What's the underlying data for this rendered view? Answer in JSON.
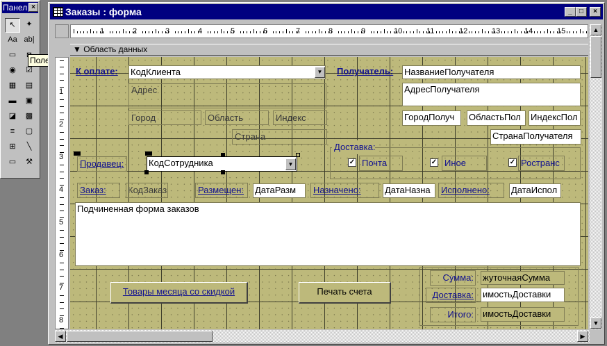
{
  "toolbox": {
    "title": "Панел",
    "tooltip": "Поле",
    "tools": [
      "↖",
      "✦",
      "Aa",
      "ab|",
      "▭",
      "◘",
      "◉",
      "☑",
      "▦",
      "▤",
      "▬",
      "▣",
      "◪",
      "▩",
      "≡",
      "▢",
      "⊞",
      "╲",
      "▭",
      "⚒"
    ]
  },
  "window": {
    "title": "Заказы : форма",
    "min": "_",
    "max": "□",
    "close": "×"
  },
  "ruler": {
    "marks": [
      "1",
      "2",
      "3",
      "4",
      "5",
      "6",
      "7",
      "8",
      "9",
      "10",
      "11",
      "12",
      "13",
      "14",
      "15"
    ],
    "vmarks": [
      "1",
      "2",
      "3",
      "4",
      "5",
      "6",
      "7",
      "8"
    ]
  },
  "section": {
    "label": "Область данных"
  },
  "form": {
    "k_oplate": "К оплате:",
    "kod_klienta": "КодКлиента",
    "adres": "Адрес",
    "gorod": "Город",
    "oblast": "Область",
    "indeks": "Индекс",
    "strana": "Страна",
    "poluchatel": "Получатель:",
    "nazv_pol": "НазваниеПолучателя",
    "adres_pol": "АдресПолучателя",
    "gorod_pol": "ГородПолуч",
    "oblast_pol": "ОбластьПол",
    "indeks_pol": "ИндексПол",
    "strana_pol": "СтранаПолучателя",
    "dostavka": "Доставка:",
    "pochta": "Почта",
    "inoe": "Иное",
    "rostrans": "Ространс",
    "prodavec": "Продавец:",
    "kod_sotr": "КодСотрудника",
    "zakaz": "Заказ:",
    "kod_zakaza": "КодЗаказ",
    "razmeshen": "Размещен:",
    "data_razm": "ДатаРазм",
    "naznacheno": "Назначено:",
    "data_nazn": "ДатаНазна",
    "ispolneno": "Исполнено:",
    "data_isp": "ДатаИспол",
    "subform": "Подчиненная форма заказов",
    "btn_tovary": "Товары месяца со скидкой",
    "btn_pechat": "Печать счета",
    "summa": "Сумма:",
    "summa_val": "жуточнаяСумма",
    "dost2": "Доставка:",
    "dost_val": "имостьДоставки",
    "itogo": "Итого:",
    "itogo_val": "имостьДоставки"
  }
}
